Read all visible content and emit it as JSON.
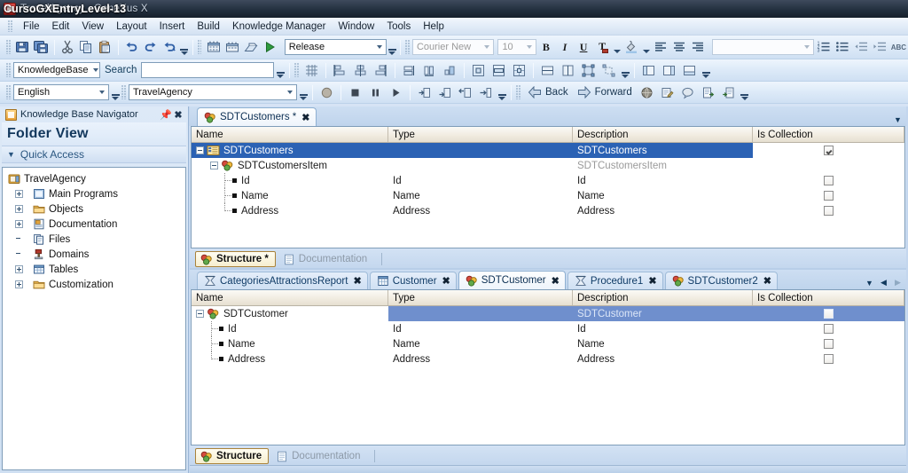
{
  "window": {
    "title": "TravelAgency - GeneXus X",
    "overlay_label": "CursoGXEntryLevel-13"
  },
  "menu": {
    "items": [
      {
        "label": "File"
      },
      {
        "label": "Edit"
      },
      {
        "label": "View"
      },
      {
        "label": "Layout"
      },
      {
        "label": "Insert"
      },
      {
        "label": "Build"
      },
      {
        "label": "Knowledge Manager"
      },
      {
        "label": "Window"
      },
      {
        "label": "Tools"
      },
      {
        "label": "Help"
      }
    ]
  },
  "toolbar_standard": {
    "buttons": [
      {
        "name": "save-icon",
        "title": "Save"
      },
      {
        "name": "save-all-icon",
        "title": "Save All"
      },
      {
        "name": "cut-icon",
        "title": "Cut"
      },
      {
        "name": "copy-icon",
        "title": "Copy"
      },
      {
        "name": "paste-icon",
        "title": "Paste"
      },
      {
        "name": "undo-icon",
        "title": "Undo"
      },
      {
        "name": "redo-icon",
        "title": "Redo"
      },
      {
        "name": "redo-all-icon",
        "title": "Redo All"
      }
    ],
    "build_buttons": [
      {
        "name": "build-all-icon",
        "title": "Build All"
      },
      {
        "name": "rebuild-all-icon",
        "title": "Rebuild All"
      },
      {
        "name": "create-icon",
        "title": "Create"
      },
      {
        "name": "run-icon",
        "title": "Run"
      }
    ],
    "configuration": "Release"
  },
  "toolbar_format": {
    "font_family": "Courier New",
    "font_size": "10",
    "bold_label": "B",
    "italic_label": "I",
    "underline_label": "U",
    "font_color_label": "T",
    "abc_label": "ABC",
    "style_value": ""
  },
  "toolbar_search": {
    "scope": "KnowledgeBase",
    "search_label": "Search",
    "search_value": "",
    "search_placeholder": ""
  },
  "toolbar_kb": {
    "language": "English",
    "knowledge_base": "TravelAgency"
  },
  "toolbar_debug": {
    "back_label": "Back",
    "forward_label": "Forward",
    "buttons": [
      {
        "name": "record-icon"
      },
      {
        "name": "stop-icon"
      },
      {
        "name": "pause-icon"
      },
      {
        "name": "play-icon"
      },
      {
        "name": "step-into-icon"
      },
      {
        "name": "step-over-icon"
      },
      {
        "name": "step-out-icon"
      },
      {
        "name": "run-to-cursor-icon"
      }
    ]
  },
  "navigator": {
    "title": "Knowledge Base Navigator",
    "pin_icon": "pin-icon",
    "close_icon": "close-icon",
    "view_title": "Folder View",
    "quick_access": "Quick Access",
    "tree": [
      {
        "label": "TravelAgency",
        "level": 0,
        "expander": "none",
        "icon": "kb-icon"
      },
      {
        "label": "Main Programs",
        "level": 1,
        "expander": "plus",
        "icon": "main-programs-icon"
      },
      {
        "label": "Objects",
        "level": 1,
        "expander": "plus",
        "icon": "folder-icon"
      },
      {
        "label": "Documentation",
        "level": 1,
        "expander": "plus",
        "icon": "documentation-icon"
      },
      {
        "label": "Files",
        "level": 1,
        "expander": "none",
        "icon": "files-icon"
      },
      {
        "label": "Domains",
        "level": 1,
        "expander": "none",
        "icon": "domains-icon"
      },
      {
        "label": "Tables",
        "level": 1,
        "expander": "plus",
        "icon": "tables-icon"
      },
      {
        "label": "Customization",
        "level": 1,
        "expander": "plus",
        "icon": "folder-icon"
      }
    ]
  },
  "top_pane": {
    "tabs": [
      {
        "label": "SDTCustomers *",
        "icon": "sdt-icon",
        "active": true,
        "closable": true
      }
    ],
    "columns": [
      "Name",
      "Type",
      "Description",
      "Is Collection"
    ],
    "rows": [
      {
        "name": "SDTCustomers",
        "type": "",
        "description": "SDTCustomers",
        "is_collection": true,
        "kind": "root",
        "selected": true,
        "icon": "sdt-collection-icon"
      },
      {
        "name": "SDTCustomersItem",
        "type": "",
        "description": "SDTCustomersItem",
        "is_collection": null,
        "kind": "item",
        "selected": false,
        "icon": "sdt-icon"
      },
      {
        "name": "Id",
        "type": "Id",
        "description": "Id",
        "is_collection": false,
        "kind": "leaf",
        "selected": false
      },
      {
        "name": "Name",
        "type": "Name",
        "description": "Name",
        "is_collection": false,
        "kind": "leaf",
        "selected": false
      },
      {
        "name": "Address",
        "type": "Address",
        "description": "Address",
        "is_collection": false,
        "kind": "leaf",
        "selected": false
      }
    ],
    "part_tabs": [
      {
        "label": "Structure *",
        "icon": "structure-icon",
        "active": true
      },
      {
        "label": "Documentation",
        "icon": "documentation-part-icon",
        "active": false
      }
    ]
  },
  "bottom_pane": {
    "tabs": [
      {
        "label": "CategoriesAttractionsReport",
        "icon": "report-icon",
        "active": false,
        "closable": true
      },
      {
        "label": "Customer",
        "icon": "transaction-icon",
        "active": false,
        "closable": true
      },
      {
        "label": "SDTCustomer",
        "icon": "sdt-icon",
        "active": true,
        "closable": true
      },
      {
        "label": "Procedure1",
        "icon": "procedure-icon",
        "active": false,
        "closable": true
      },
      {
        "label": "SDTCustomer2",
        "icon": "sdt-icon",
        "active": false,
        "closable": true
      }
    ],
    "tab_nav": [
      "tab-list-icon",
      "tab-prev-icon",
      "tab-next-icon"
    ],
    "columns": [
      "Name",
      "Type",
      "Description",
      "Is Collection"
    ],
    "rows": [
      {
        "name": "SDTCustomer",
        "type": "",
        "description": "SDTCustomer",
        "is_collection": false,
        "kind": "root",
        "selected": true,
        "icon": "sdt-icon"
      },
      {
        "name": "Id",
        "type": "Id",
        "description": "Id",
        "is_collection": false,
        "kind": "leaf",
        "selected": false
      },
      {
        "name": "Name",
        "type": "Name",
        "description": "Name",
        "is_collection": false,
        "kind": "leaf",
        "selected": false
      },
      {
        "name": "Address",
        "type": "Address",
        "description": "Address",
        "is_collection": false,
        "kind": "leaf",
        "selected": false
      }
    ],
    "part_tabs": [
      {
        "label": "Structure",
        "icon": "structure-icon",
        "active": true
      },
      {
        "label": "Documentation",
        "icon": "documentation-part-icon",
        "active": false
      }
    ]
  },
  "colors": {
    "selection_blue": "#2b62b4",
    "selection_soft": "#6f8fcd",
    "chrome_blue": "#cfe0f3",
    "title_dark": "#23303f"
  }
}
